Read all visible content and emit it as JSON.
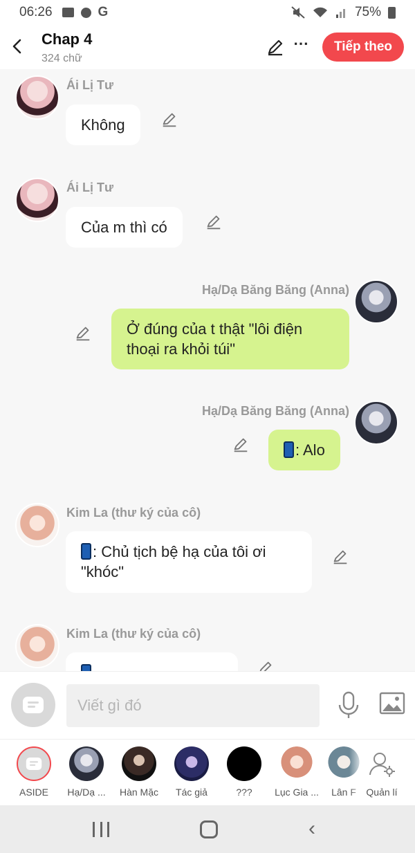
{
  "status": {
    "time": "06:26",
    "battery": "75%",
    "icons": [
      "image-icon",
      "chat-dot-icon",
      "google-icon",
      "mute-icon",
      "wifi-icon",
      "signal-icon",
      "battery-icon"
    ]
  },
  "header": {
    "back_icon": "chevron-left-icon",
    "title": "Chap 4",
    "subtitle": "324 chữ",
    "edit_icon": "pencil-icon",
    "more_icon": "more-dots-icon",
    "next_label": "Tiếp theo",
    "next_color": "#f2484d"
  },
  "messages": [
    {
      "sender": "Ái Lị Tư",
      "side": "left",
      "text": "Không"
    },
    {
      "sender": "Ái Lị Tư",
      "side": "left",
      "text": "Của m thì có"
    },
    {
      "sender": "Hạ/Dạ Băng Băng (Anna)",
      "side": "right",
      "text_line1": "Ở đúng của t thật \"lôi điện",
      "text_line2": "thoại ra khỏi túi\""
    },
    {
      "sender": "Hạ/Dạ Băng Băng (Anna)",
      "side": "right",
      "text": ": Alo",
      "emoji": "phone-icon"
    },
    {
      "sender": "Kim La (thư ký của cô)",
      "side": "left",
      "text_line1": ": Chủ tịch bệ hạ của tôi ơi",
      "text_line2": "\"khóc\"",
      "emoji": "phone-icon"
    },
    {
      "sender": "Kim La (thư ký của cô)",
      "side": "left",
      "text": ""
    }
  ],
  "colors": {
    "left_bubble": "#ffffff",
    "right_bubble": "#d6f38f",
    "background": "#f7f7f7"
  },
  "input": {
    "placeholder": "Viết gì đó",
    "value": "",
    "mic_icon": "microphone-icon",
    "image_icon": "image-icon"
  },
  "characters": [
    {
      "label": "ASIDE"
    },
    {
      "label": "Hạ/Dạ ..."
    },
    {
      "label": "Hàn Mặc"
    },
    {
      "label": "Tác giả"
    },
    {
      "label": "???"
    },
    {
      "label": "Lục Gia ..."
    },
    {
      "label": "Lân F"
    },
    {
      "label": "Quản lí"
    }
  ]
}
